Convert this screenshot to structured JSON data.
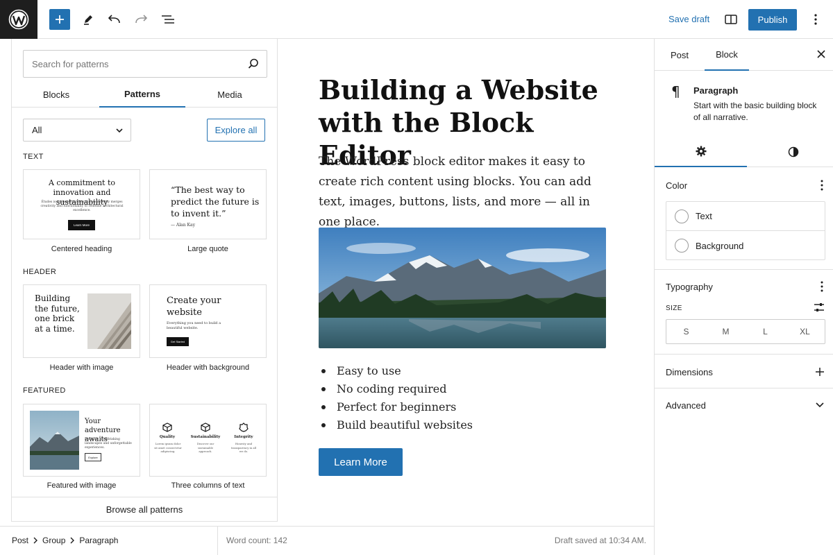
{
  "topbar": {
    "save_draft": "Save draft",
    "publish": "Publish",
    "accent_color": "#2271b1"
  },
  "inserter": {
    "search_placeholder": "Search for patterns",
    "tabs": [
      "Blocks",
      "Patterns",
      "Media"
    ],
    "active_tab": "Patterns",
    "filter_value": "All",
    "explore_all": "Explore all",
    "categories": {
      "text": "TEXT",
      "header": "HEADER",
      "featured": "FEATURED"
    },
    "patterns": {
      "centered_heading": {
        "label": "Centered heading",
        "heading": "A commitment to innovation and sustainability",
        "body": "Études is a pioneering firm that seamlessly merges creativity and functionality to redefine architectural excellence.",
        "button": "Learn More"
      },
      "large_quote": {
        "label": "Large quote",
        "quote": "“The best way to predict the future is to invent it.”",
        "author": "— Alan Kay"
      },
      "header_with_image": {
        "label": "Header with image",
        "heading": "Building the future, one brick at a time."
      },
      "header_with_background": {
        "label": "Header with background",
        "heading": "Create your website",
        "body": "Everything you need to build a beautiful website.",
        "button": "Get Started"
      },
      "featured_with_image": {
        "label": "Featured with image",
        "heading": "Your adventure awaits",
        "body": "Discover breathtaking landscapes and unforgettable experiences.",
        "button": "Explore"
      },
      "three_columns": {
        "label": "Three columns of text",
        "columns": [
          {
            "title": "Quality",
            "body": "Lorem ipsum dolor sit amet consectetur adipiscing."
          },
          {
            "title": "Sustainability",
            "body": "Discover our sustainable approach."
          },
          {
            "title": "Integrity",
            "body": "Honesty and transparency in all we do."
          }
        ]
      }
    },
    "browse_all": "Browse all patterns"
  },
  "post": {
    "title": "Building a Website with the Block Editor",
    "paragraph": "The WordPress block editor makes it easy to create rich content using blocks. You can add text, images, buttons, lists, and more — all in one place.",
    "list": [
      "Easy to use",
      "No coding required",
      "Perfect for beginners",
      "Build beautiful websites"
    ],
    "button": "Learn More"
  },
  "footer": {
    "breadcrumbs": [
      "Post",
      "Group",
      "Paragraph"
    ],
    "word_count": "Word count: 142",
    "draft_saved": "Draft saved at 10:34 AM."
  },
  "sidebar": {
    "tabs": [
      "Post",
      "Block"
    ],
    "active_tab": "Block",
    "block_name": "Paragraph",
    "block_description": "Start with the basic building block of all narrative.",
    "color_section": "Color",
    "color_items": [
      "Text",
      "Background"
    ],
    "typography_section": "Typography",
    "size_label": "SIZE",
    "sizes": [
      "S",
      "M",
      "L",
      "XL"
    ],
    "dimensions_section": "Dimensions",
    "advanced_section": "Advanced"
  }
}
